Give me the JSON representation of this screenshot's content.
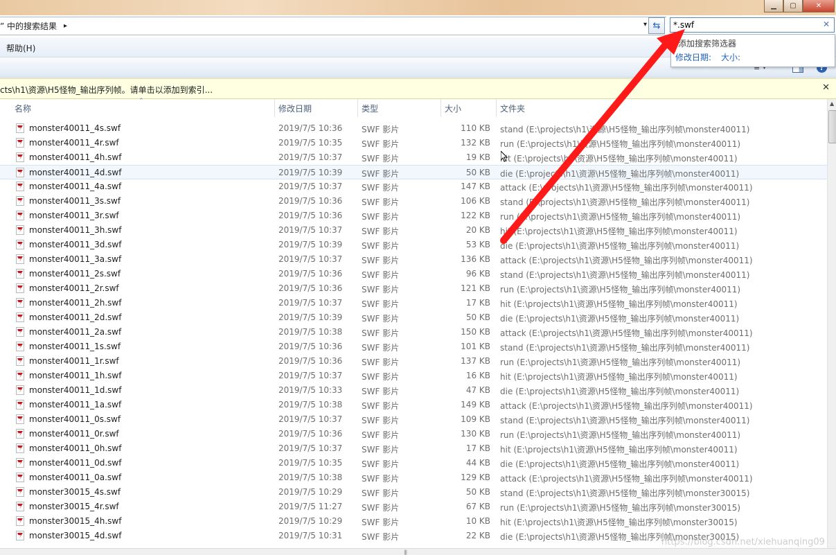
{
  "window": {
    "minimize": "▁",
    "maximize": "▢",
    "close": "✕"
  },
  "address": {
    "text": "” 中的搜索结果",
    "chevron": "▸",
    "dropdown": "▾",
    "refresh_icon": "⇆"
  },
  "search": {
    "value": "*.swf",
    "clear_icon": "✕"
  },
  "menu": {
    "help": "帮助(H)"
  },
  "toolbar": {
    "views_icon": "≣ ▾",
    "help_icon": "?"
  },
  "filter_popup": {
    "title": "添加搜索筛选器",
    "date_filter": "修改日期:",
    "size_filter": "大小:"
  },
  "infobar": {
    "text": "cts\\h1\\资源\\H5怪物_输出序列帧。请单击以添加到索引...",
    "close_icon": "✕"
  },
  "columns": {
    "name": "名称",
    "date": "修改日期",
    "type": "类型",
    "size": "大小",
    "folder": "文件夹"
  },
  "files": [
    {
      "name": "monster40011_4s.swf",
      "date": "2019/7/5 10:36",
      "type": "SWF 影片",
      "size": "110 KB",
      "folder": "stand (E:\\projects\\h1\\资源\\H5怪物_输出序列帧\\monster40011)"
    },
    {
      "name": "monster40011_4r.swf",
      "date": "2019/7/5 10:35",
      "type": "SWF 影片",
      "size": "132 KB",
      "folder": "run (E:\\projects\\h1\\资源\\H5怪物_输出序列帧\\monster40011)"
    },
    {
      "name": "monster40011_4h.swf",
      "date": "2019/7/5 10:37",
      "type": "SWF 影片",
      "size": "19 KB",
      "folder": "hit (E:\\projects\\h1\\资源\\H5怪物_输出序列帧\\monster40011)"
    },
    {
      "name": "monster40011_4d.swf",
      "date": "2019/7/5 10:39",
      "type": "SWF 影片",
      "size": "50 KB",
      "folder": "die (E:\\projects\\h1\\资源\\H5怪物_输出序列帧\\monster40011)"
    },
    {
      "name": "monster40011_4a.swf",
      "date": "2019/7/5 10:37",
      "type": "SWF 影片",
      "size": "147 KB",
      "folder": "attack (E:\\projects\\h1\\资源\\H5怪物_输出序列帧\\monster40011)"
    },
    {
      "name": "monster40011_3s.swf",
      "date": "2019/7/5 10:36",
      "type": "SWF 影片",
      "size": "106 KB",
      "folder": "stand (E:\\projects\\h1\\资源\\H5怪物_输出序列帧\\monster40011)"
    },
    {
      "name": "monster40011_3r.swf",
      "date": "2019/7/5 10:36",
      "type": "SWF 影片",
      "size": "122 KB",
      "folder": "run (E:\\projects\\h1\\资源\\H5怪物_输出序列帧\\monster40011)"
    },
    {
      "name": "monster40011_3h.swf",
      "date": "2019/7/5 10:37",
      "type": "SWF 影片",
      "size": "20 KB",
      "folder": "hit (E:\\projects\\h1\\资源\\H5怪物_输出序列帧\\monster40011)"
    },
    {
      "name": "monster40011_3d.swf",
      "date": "2019/7/5 10:39",
      "type": "SWF 影片",
      "size": "53 KB",
      "folder": "die (E:\\projects\\h1\\资源\\H5怪物_输出序列帧\\monster40011)"
    },
    {
      "name": "monster40011_3a.swf",
      "date": "2019/7/5 10:37",
      "type": "SWF 影片",
      "size": "136 KB",
      "folder": "attack (E:\\projects\\h1\\资源\\H5怪物_输出序列帧\\monster40011)"
    },
    {
      "name": "monster40011_2s.swf",
      "date": "2019/7/5 10:36",
      "type": "SWF 影片",
      "size": "96 KB",
      "folder": "stand (E:\\projects\\h1\\资源\\H5怪物_输出序列帧\\monster40011)"
    },
    {
      "name": "monster40011_2r.swf",
      "date": "2019/7/5 10:36",
      "type": "SWF 影片",
      "size": "121 KB",
      "folder": "run (E:\\projects\\h1\\资源\\H5怪物_输出序列帧\\monster40011)"
    },
    {
      "name": "monster40011_2h.swf",
      "date": "2019/7/5 10:37",
      "type": "SWF 影片",
      "size": "17 KB",
      "folder": "hit (E:\\projects\\h1\\资源\\H5怪物_输出序列帧\\monster40011)"
    },
    {
      "name": "monster40011_2d.swf",
      "date": "2019/7/5 10:39",
      "type": "SWF 影片",
      "size": "50 KB",
      "folder": "die (E:\\projects\\h1\\资源\\H5怪物_输出序列帧\\monster40011)"
    },
    {
      "name": "monster40011_2a.swf",
      "date": "2019/7/5 10:38",
      "type": "SWF 影片",
      "size": "150 KB",
      "folder": "attack (E:\\projects\\h1\\资源\\H5怪物_输出序列帧\\monster40011)"
    },
    {
      "name": "monster40011_1s.swf",
      "date": "2019/7/5 10:36",
      "type": "SWF 影片",
      "size": "101 KB",
      "folder": "stand (E:\\projects\\h1\\资源\\H5怪物_输出序列帧\\monster40011)"
    },
    {
      "name": "monster40011_1r.swf",
      "date": "2019/7/5 10:36",
      "type": "SWF 影片",
      "size": "137 KB",
      "folder": "run (E:\\projects\\h1\\资源\\H5怪物_输出序列帧\\monster40011)"
    },
    {
      "name": "monster40011_1h.swf",
      "date": "2019/7/5 10:37",
      "type": "SWF 影片",
      "size": "16 KB",
      "folder": "hit (E:\\projects\\h1\\资源\\H5怪物_输出序列帧\\monster40011)"
    },
    {
      "name": "monster40011_1d.swf",
      "date": "2019/7/5 10:33",
      "type": "SWF 影片",
      "size": "47 KB",
      "folder": "die (E:\\projects\\h1\\资源\\H5怪物_输出序列帧\\monster40011)"
    },
    {
      "name": "monster40011_1a.swf",
      "date": "2019/7/5 10:38",
      "type": "SWF 影片",
      "size": "149 KB",
      "folder": "attack (E:\\projects\\h1\\资源\\H5怪物_输出序列帧\\monster40011)"
    },
    {
      "name": "monster40011_0s.swf",
      "date": "2019/7/5 10:37",
      "type": "SWF 影片",
      "size": "109 KB",
      "folder": "stand (E:\\projects\\h1\\资源\\H5怪物_输出序列帧\\monster40011)"
    },
    {
      "name": "monster40011_0r.swf",
      "date": "2019/7/5 10:36",
      "type": "SWF 影片",
      "size": "130 KB",
      "folder": "run (E:\\projects\\h1\\资源\\H5怪物_输出序列帧\\monster40011)"
    },
    {
      "name": "monster40011_0h.swf",
      "date": "2019/7/5 10:37",
      "type": "SWF 影片",
      "size": "17 KB",
      "folder": "hit (E:\\projects\\h1\\资源\\H5怪物_输出序列帧\\monster40011)"
    },
    {
      "name": "monster40011_0d.swf",
      "date": "2019/7/5 10:35",
      "type": "SWF 影片",
      "size": "44 KB",
      "folder": "die (E:\\projects\\h1\\资源\\H5怪物_输出序列帧\\monster40011)"
    },
    {
      "name": "monster40011_0a.swf",
      "date": "2019/7/5 10:38",
      "type": "SWF 影片",
      "size": "129 KB",
      "folder": "attack (E:\\projects\\h1\\资源\\H5怪物_输出序列帧\\monster40011)"
    },
    {
      "name": "monster30015_4s.swf",
      "date": "2019/7/5 10:29",
      "type": "SWF 影片",
      "size": "50 KB",
      "folder": "stand (E:\\projects\\h1\\资源\\H5怪物_输出序列帧\\monster30015)"
    },
    {
      "name": "monster30015_4r.swf",
      "date": "2019/7/5 11:27",
      "type": "SWF 影片",
      "size": "67 KB",
      "folder": "run (E:\\projects\\h1\\资源\\H5怪物_输出序列帧\\monster30015)"
    },
    {
      "name": "monster30015_4h.swf",
      "date": "2019/7/5 10:29",
      "type": "SWF 影片",
      "size": "10 KB",
      "folder": "hit (E:\\projects\\h1\\资源\\H5怪物_输出序列帧\\monster30015)"
    },
    {
      "name": "monster30015_4d.swf",
      "date": "2019/7/5 10:31",
      "type": "SWF 影片",
      "size": "22 KB",
      "folder": "die (E:\\projects\\h1\\资源\\H5怪物_输出序列帧\\monster30015)"
    }
  ],
  "selected_row": 3,
  "scrollbar": {
    "up_icon": "▲",
    "grip_icon": "|||"
  },
  "watermark": "https://blog.csdn.net/xiehuanqing09",
  "colors": {
    "arrow": "#ff1a1a",
    "infobar_bg": "#ffffe1",
    "selection": "#f2f7fd",
    "link": "#1f5fbf"
  }
}
